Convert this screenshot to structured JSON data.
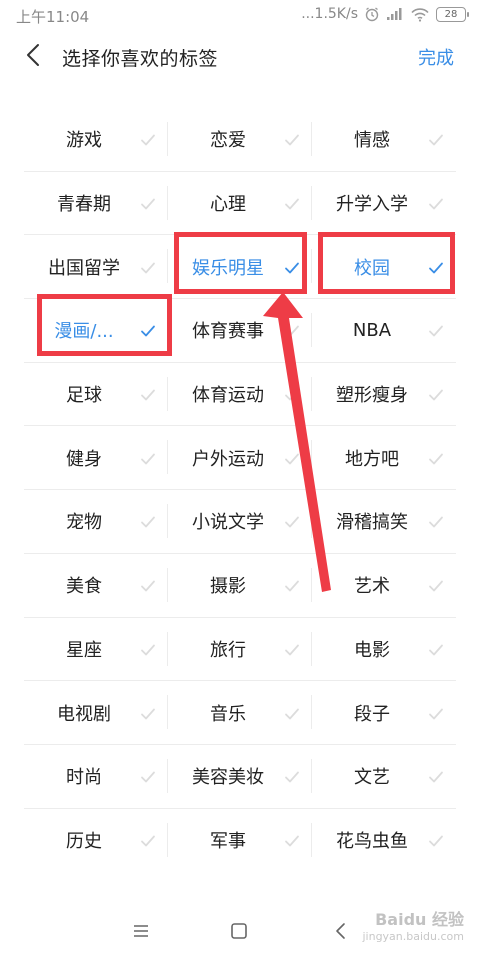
{
  "status_bar": {
    "time": "上午11:04",
    "network_speed": "...1.5K/s",
    "battery_level": "28"
  },
  "header": {
    "title": "选择你喜欢的标签",
    "done_label": "完成"
  },
  "accent_color": "#3a8ee6",
  "highlight_color": "#ee3c46",
  "tags": [
    [
      {
        "label": "游戏",
        "selected": false
      },
      {
        "label": "恋爱",
        "selected": false
      },
      {
        "label": "情感",
        "selected": false
      }
    ],
    [
      {
        "label": "青春期",
        "selected": false
      },
      {
        "label": "心理",
        "selected": false
      },
      {
        "label": "升学入学",
        "selected": false
      }
    ],
    [
      {
        "label": "出国留学",
        "selected": false
      },
      {
        "label": "娱乐明星",
        "selected": true
      },
      {
        "label": "校园",
        "selected": true
      }
    ],
    [
      {
        "label": "漫画/...",
        "selected": true
      },
      {
        "label": "体育赛事",
        "selected": false
      },
      {
        "label": "NBA",
        "selected": false
      }
    ],
    [
      {
        "label": "足球",
        "selected": false
      },
      {
        "label": "体育运动",
        "selected": false
      },
      {
        "label": "塑形瘦身",
        "selected": false
      }
    ],
    [
      {
        "label": "健身",
        "selected": false
      },
      {
        "label": "户外运动",
        "selected": false
      },
      {
        "label": "地方吧",
        "selected": false
      }
    ],
    [
      {
        "label": "宠物",
        "selected": false
      },
      {
        "label": "小说文学",
        "selected": false
      },
      {
        "label": "滑稽搞笑",
        "selected": false
      }
    ],
    [
      {
        "label": "美食",
        "selected": false
      },
      {
        "label": "摄影",
        "selected": false
      },
      {
        "label": "艺术",
        "selected": false
      }
    ],
    [
      {
        "label": "星座",
        "selected": false
      },
      {
        "label": "旅行",
        "selected": false
      },
      {
        "label": "电影",
        "selected": false
      }
    ],
    [
      {
        "label": "电视剧",
        "selected": false
      },
      {
        "label": "音乐",
        "selected": false
      },
      {
        "label": "段子",
        "selected": false
      }
    ],
    [
      {
        "label": "时尚",
        "selected": false
      },
      {
        "label": "美容美妆",
        "selected": false
      },
      {
        "label": "文艺",
        "selected": false
      }
    ],
    [
      {
        "label": "历史",
        "selected": false
      },
      {
        "label": "军事",
        "selected": false
      },
      {
        "label": "花鸟虫鱼",
        "selected": false
      }
    ]
  ],
  "watermark": {
    "main": "Baidu 经验",
    "sub": "jingyan.baidu.com"
  },
  "icons": {
    "back": "chevron-left-icon",
    "check": "check-icon",
    "menu": "menu-icon",
    "home": "home-icon",
    "nav_back": "nav-back-icon"
  }
}
